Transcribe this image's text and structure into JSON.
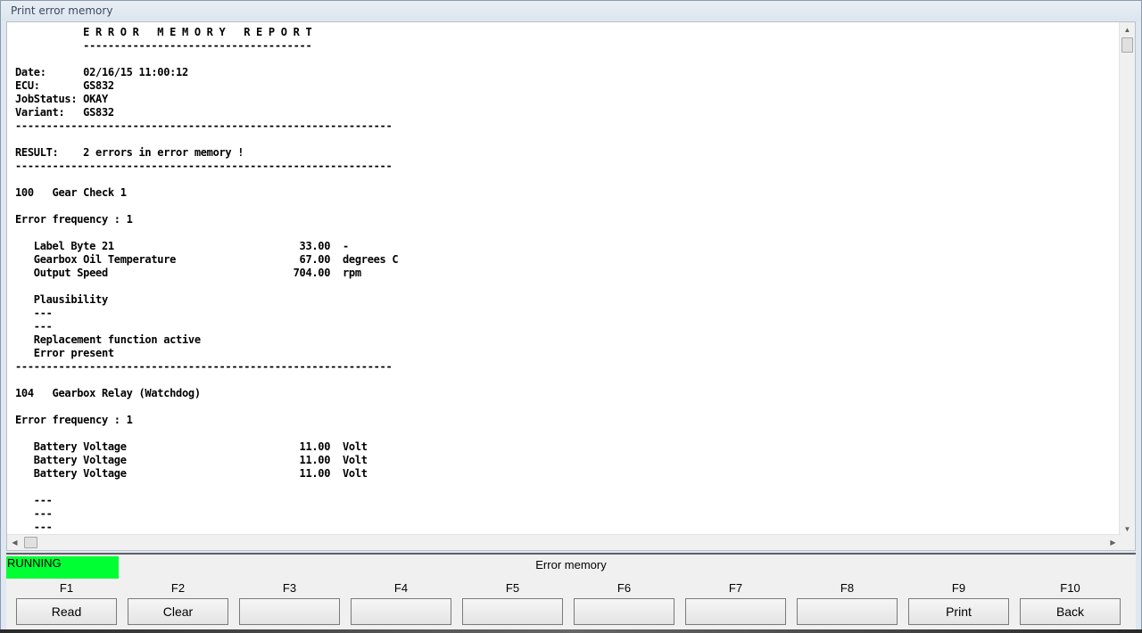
{
  "window": {
    "title": "Print error memory"
  },
  "report": {
    "lines": [
      "           E R R O R   M E M O R Y   R E P O R T",
      "           -------------------------------------",
      "",
      "Date:      02/16/15 11:00:12",
      "ECU:       GS832",
      "JobStatus: OKAY",
      "Variant:   GS832",
      "-------------------------------------------------------------",
      "",
      "RESULT:    2 errors in error memory !",
      "-------------------------------------------------------------",
      "",
      "100   Gear Check 1",
      "",
      "Error frequency : 1",
      "",
      "   Label Byte 21                              33.00  -",
      "   Gearbox Oil Temperature                    67.00  degrees C",
      "   Output Speed                              704.00  rpm",
      "",
      "   Plausibility",
      "   ---",
      "   ---",
      "   Replacement function active",
      "   Error present",
      "-------------------------------------------------------------",
      "",
      "104   Gearbox Relay (Watchdog)",
      "",
      "Error frequency : 1",
      "",
      "   Battery Voltage                            11.00  Volt",
      "   Battery Voltage                            11.00  Volt",
      "   Battery Voltage                            11.00  Volt",
      "",
      "   ---",
      "   ---",
      "   ---"
    ]
  },
  "status": {
    "state": "RUNNING",
    "state_color": "#00ff33",
    "title": "Error memory"
  },
  "function_keys": [
    {
      "key": "F1",
      "label": "Read"
    },
    {
      "key": "F2",
      "label": "Clear"
    },
    {
      "key": "F3",
      "label": ""
    },
    {
      "key": "F4",
      "label": ""
    },
    {
      "key": "F5",
      "label": ""
    },
    {
      "key": "F6",
      "label": ""
    },
    {
      "key": "F7",
      "label": ""
    },
    {
      "key": "F8",
      "label": ""
    },
    {
      "key": "F9",
      "label": "Print"
    },
    {
      "key": "F10",
      "label": "Back"
    }
  ]
}
